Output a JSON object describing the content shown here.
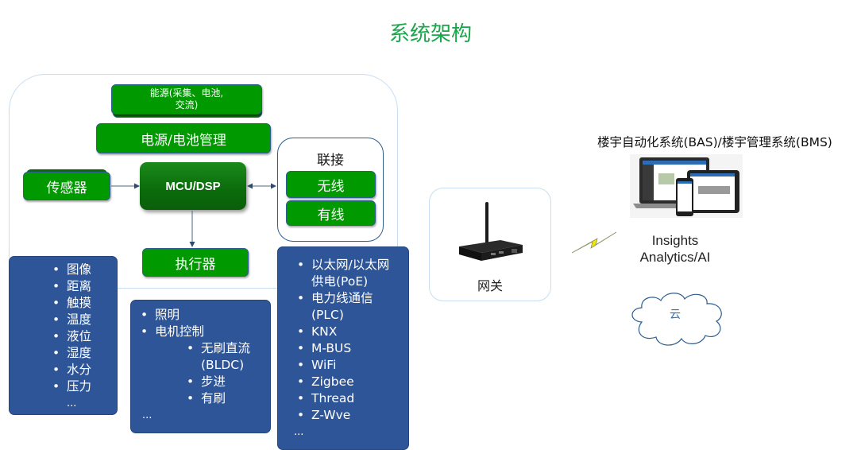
{
  "title": "系统架构",
  "node": {
    "energy": "能源(采集、电池、交流)",
    "energy_line1": "能源(采集、电池,",
    "energy_line2": "交流)",
    "power_mgmt": "电源/电池管理",
    "sensor": "传感器",
    "mcu": "MCU/DSP",
    "actuator": "执行器",
    "connectivity": {
      "title": "联接",
      "wireless": "无线",
      "wired": "有线"
    },
    "gateway": "网关",
    "bms": "楼宇自动化系统(BAS)/楼宇管理系统(BMS)",
    "insights_line1": "Insights",
    "insights_line2": "Analytics/AI",
    "cloud": "云"
  },
  "sensor_types": [
    "图像",
    "距离",
    "触摸",
    "温度",
    "液位",
    "湿度",
    "水分",
    "压力"
  ],
  "sensor_more": "...",
  "actuator_types": {
    "items": [
      "照明",
      "电机控制"
    ],
    "motor_sub": [
      "无刷直流(BLDC)",
      "步进",
      "有刷"
    ],
    "more": "..."
  },
  "connectivity_types": [
    "以太网/以太网供电(PoE)",
    "电力线通信(PLC)",
    "KNX",
    "M-BUS",
    "WiFi",
    "Zigbee",
    "Thread",
    "Z-Wve"
  ],
  "connectivity_more": "...",
  "colors": {
    "title_green": "#1aa64a",
    "box_green": "#009900",
    "mcu_green": "#0b6b0b",
    "list_blue": "#2e5597",
    "border_blue": "#2e5d8e",
    "outline_light_blue": "#c9ddf0",
    "lightning_yellow": "#f2e600"
  }
}
